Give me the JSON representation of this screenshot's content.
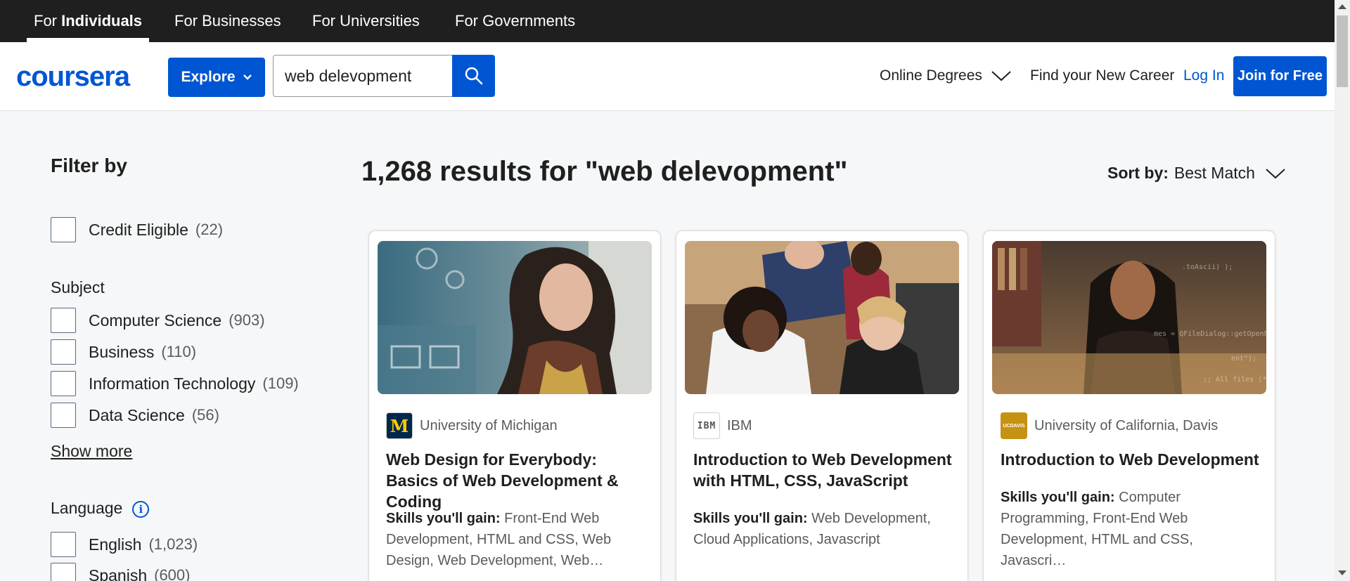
{
  "audience_nav": {
    "individuals_prefix": "For ",
    "individuals_bold": "Individuals",
    "businesses": "For Businesses",
    "universities": "For Universities",
    "governments": "For Governments"
  },
  "header": {
    "logo_text": "coursera",
    "explore_label": "Explore",
    "search_value": "web delevopment",
    "online_degrees": "Online Degrees",
    "find_career": "Find your New Career",
    "login": "Log In",
    "join": "Join for Free"
  },
  "filters": {
    "title": "Filter by",
    "credit_eligible": {
      "label": "Credit Eligible",
      "count": "(22)"
    },
    "subject": {
      "title": "Subject",
      "options": [
        {
          "label": "Computer Science",
          "count": "(903)"
        },
        {
          "label": "Business",
          "count": "(110)"
        },
        {
          "label": "Information Technology",
          "count": "(109)"
        },
        {
          "label": "Data Science",
          "count": "(56)"
        }
      ],
      "show_more": "Show more"
    },
    "language": {
      "title": "Language",
      "info_icon": "i",
      "options": [
        {
          "label": "English",
          "count": "(1,023)"
        },
        {
          "label": "Spanish",
          "count": "(600)"
        }
      ]
    }
  },
  "results": {
    "title": "1,268 results for \"web delevopment\"",
    "sort_label": "Sort by:",
    "sort_value": "Best Match"
  },
  "cards": [
    {
      "partner": "University of Michigan",
      "partner_logo_text": "M",
      "title": "Web Design for Everybody: Basics of Web Development & Coding",
      "skills_label": "Skills you'll gain:",
      "skills": " Front-End Web Development, HTML and CSS, Web Design, Web Development, Web…"
    },
    {
      "partner": "IBM",
      "partner_logo_text": "IBM",
      "title": "Introduction to Web Development with HTML, CSS, JavaScript",
      "skills_label": "Skills you'll gain:",
      "skills": " Web Development, Cloud Applications, Javascript"
    },
    {
      "partner": "University of California, Davis",
      "partner_logo_text": "UCDAVIS",
      "title": "Introduction to Web Development",
      "skills_label": "Skills you'll gain:",
      "skills": " Computer Programming, Front-End Web Development, HTML and CSS, Javascri…"
    }
  ],
  "colors": {
    "brand_blue": "#0056d2",
    "top_bar": "#1f1f1f",
    "page_bg": "#f5f7f8",
    "michigan_blue": "#00274c",
    "michigan_maize": "#ffcb05",
    "ucdavis_gold": "#c69214"
  }
}
